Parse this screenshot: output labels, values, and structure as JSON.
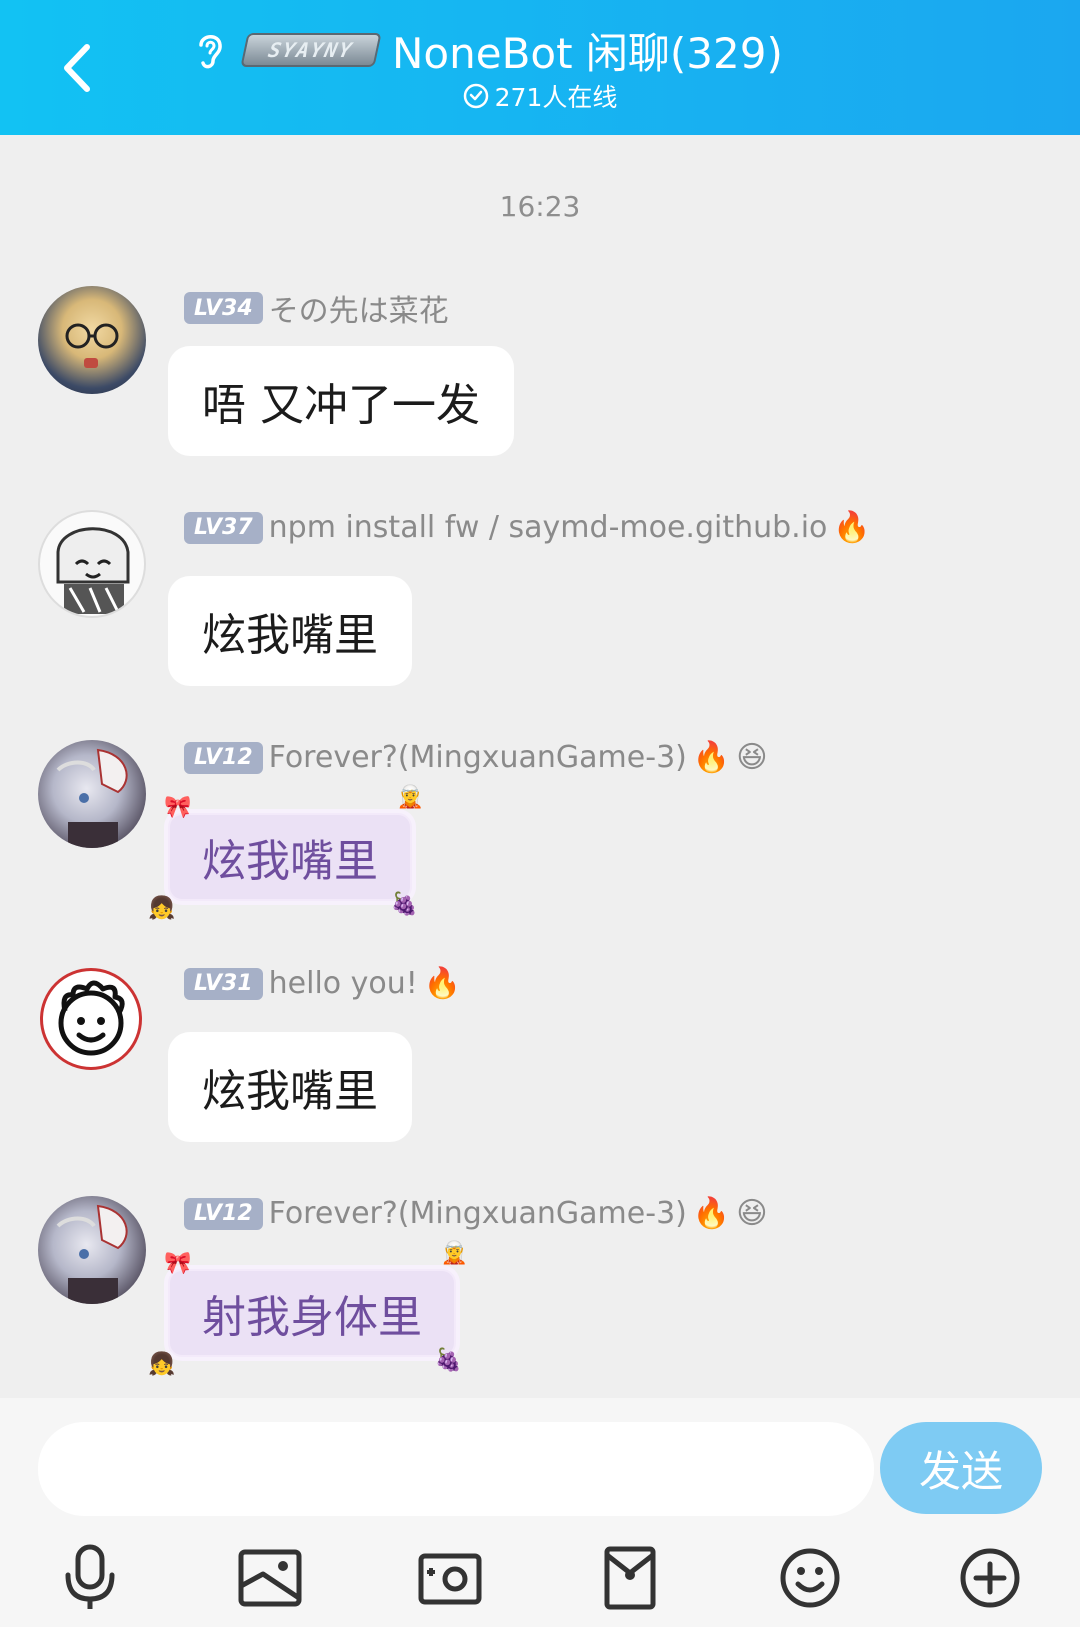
{
  "header": {
    "title": "NoneBot 闲聊(329)",
    "badge_text": "SYAYNY",
    "online": "271人在线",
    "bg_color": "#12c2f3"
  },
  "timestamp": "16:23",
  "messages": [
    {
      "level": "LV34",
      "name": "その先は菜花",
      "text": "唔 又冲了一发",
      "style": "plain",
      "icons": []
    },
    {
      "level": "LV37",
      "name": "npm install fw / saymd-moe.github.io",
      "text": "炫我嘴里",
      "style": "plain",
      "icons": [
        "fire-icon"
      ]
    },
    {
      "level": "LV12",
      "name": "Forever?(MingxuanGame-3)",
      "text": "炫我嘴里",
      "style": "fancy",
      "icons": [
        "flame-icon",
        "smile-flower-icon"
      ]
    },
    {
      "level": "LV31",
      "name": "hello you!",
      "text": "炫我嘴里",
      "style": "plain",
      "icons": [
        "fire-icon"
      ]
    },
    {
      "level": "LV12",
      "name": "Forever?(MingxuanGame-3)",
      "text": "射我身体里",
      "style": "fancy",
      "icons": [
        "flame-icon",
        "smile-flower-icon"
      ]
    }
  ],
  "input": {
    "placeholder": "",
    "send_label": "发送",
    "send_color": "#7ecbf3"
  },
  "toolbar": [
    "microphone-icon",
    "image-icon",
    "camera-icon",
    "red-packet-icon",
    "emoji-icon",
    "plus-icon"
  ]
}
